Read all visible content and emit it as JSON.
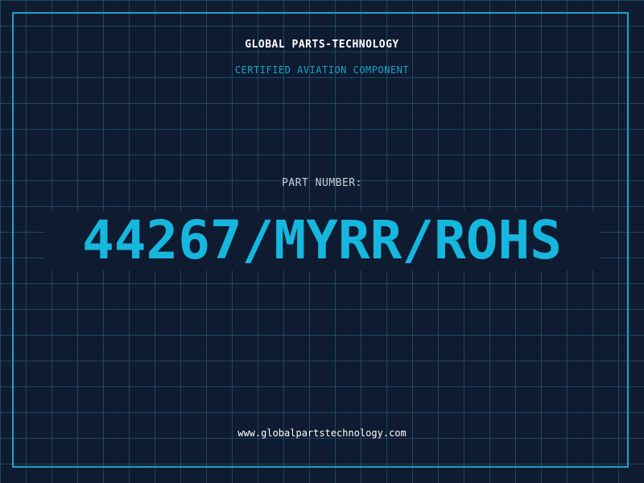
{
  "header": {
    "company": "GLOBAL PARTS-TECHNOLOGY",
    "tagline": "CERTIFIED AVIATION COMPONENT"
  },
  "main": {
    "part_label": "PART NUMBER:",
    "part_number": "44267/MYRR/ROHS"
  },
  "footer": {
    "website": "www.globalpartstechnology.com"
  },
  "colors": {
    "background": "#0f1b30",
    "accent": "#1aa3c9",
    "part_number": "#16b7de",
    "text": "#ffffff"
  }
}
